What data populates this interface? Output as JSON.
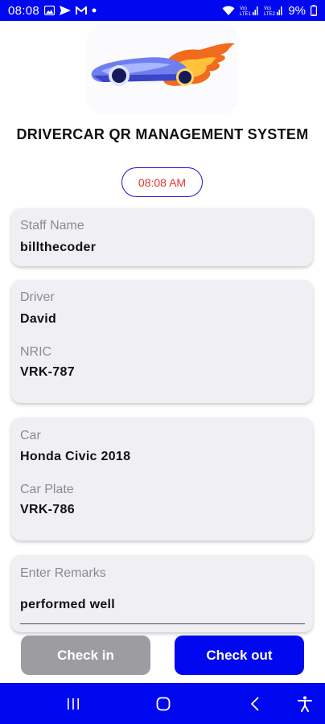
{
  "status_bar": {
    "time": "08:08",
    "battery_percent": "9%",
    "sim1_tag": "Vo)) LTE1",
    "sim2_tag": "Vo)) LTE2",
    "icons": [
      "image-icon",
      "send-icon",
      "gmail-icon",
      "notification-dot-icon",
      "wifi-icon",
      "signal-icon",
      "battery-icon"
    ]
  },
  "header": {
    "logo_icon": "race-car-flame-logo",
    "title": "DRIVERCAR QR MANAGEMENT SYSTEM",
    "clock": "08:08 AM"
  },
  "staff": {
    "label": "Staff Name",
    "value": "billthecoder"
  },
  "driver": {
    "driver_label": "Driver",
    "driver_value": "David",
    "nric_label": "NRIC",
    "nric_value": "VRK-787"
  },
  "car": {
    "car_label": "Car",
    "car_value": "Honda Civic 2018",
    "plate_label": "Car Plate",
    "plate_value": "VRK-786"
  },
  "remarks": {
    "placeholder": "Enter Remarks",
    "value": "performed well"
  },
  "actions": {
    "check_in": "Check in",
    "check_out": "Check out"
  },
  "nav_bar": {
    "icons": [
      "recent-apps-icon",
      "home-icon",
      "back-icon",
      "accessibility-icon"
    ]
  },
  "colors": {
    "primary": "#0008f0",
    "clock_text": "#e0352b",
    "card_bg": "#efeff4",
    "disabled_button": "#9d9da1"
  }
}
